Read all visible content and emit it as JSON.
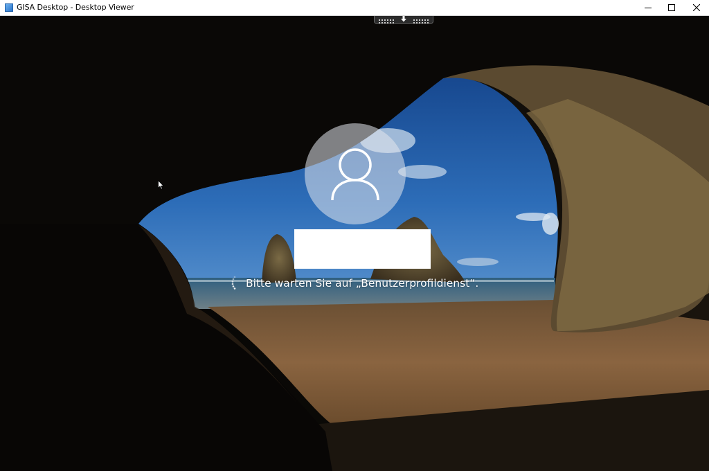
{
  "window": {
    "title": "GISA Desktop - Desktop Viewer",
    "icon": "app-window-icon",
    "buttons": [
      "minimize-icon",
      "maximize-icon",
      "close-icon"
    ]
  },
  "toolbar_handle": {
    "icon": "arrow-down-icon"
  },
  "login": {
    "avatar_icon": "user-icon",
    "username_value": "",
    "status_text": "Bitte warten Sie auf „Benutzerprofildienst“.",
    "spinner_icon": "loading-spinner-icon"
  },
  "colors": {
    "titlebar_bg": "#ffffff",
    "sky_top": "#1f5aa3",
    "sand": "#7a5a36",
    "overlay_text": "#ffffff"
  }
}
